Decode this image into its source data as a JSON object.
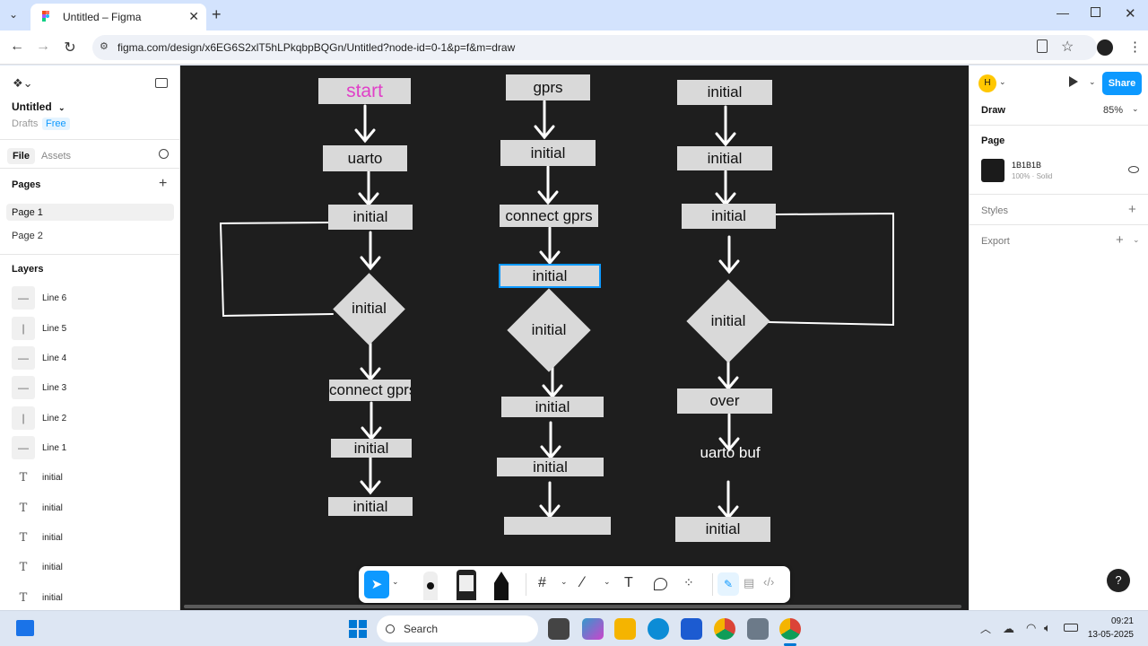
{
  "browser": {
    "tab_title": "Untitled – Figma",
    "url": "figma.com/design/x6EG6S2xlT5hLPkqbpBQGn/Untitled?node-id=0-1&p=f&m=draw"
  },
  "left_panel": {
    "file_name": "Untitled",
    "drafts": "Drafts",
    "plan_badge": "Free",
    "tab_file": "File",
    "tab_assets": "Assets",
    "pages_title": "Pages",
    "pages": [
      "Page 1",
      "Page 2"
    ],
    "layers_title": "Layers",
    "layers": [
      {
        "name": "Line 6",
        "kind": "line"
      },
      {
        "name": "Line 5",
        "kind": "line"
      },
      {
        "name": "Line 4",
        "kind": "line"
      },
      {
        "name": "Line 3",
        "kind": "line"
      },
      {
        "name": "Line 2",
        "kind": "line"
      },
      {
        "name": "Line 1",
        "kind": "line"
      },
      {
        "name": "initial",
        "kind": "text"
      },
      {
        "name": "initial",
        "kind": "text"
      },
      {
        "name": "initial",
        "kind": "text"
      },
      {
        "name": "initial",
        "kind": "text"
      },
      {
        "name": "initial",
        "kind": "text"
      }
    ]
  },
  "canvas": {
    "col1": [
      "start",
      "uarto",
      "initial",
      "initial",
      "connect gprs",
      "initial",
      "initial"
    ],
    "col2": [
      "gprs",
      "initial",
      "connect gprs",
      "initial",
      "initial",
      "initial",
      "initial",
      ""
    ],
    "col3": [
      "initial",
      "initial",
      "initial",
      "initial",
      "over",
      "uarto buf",
      "initial"
    ],
    "start_color": "#e040c8",
    "selection_color": "#0d99ff"
  },
  "right_panel": {
    "avatar_letter": "H",
    "share_label": "Share",
    "mode_label": "Draw",
    "zoom": "85%",
    "page_section": "Page",
    "page_color_hex": "1B1B1B",
    "page_color_detail": "100% · Solid",
    "styles_label": "Styles",
    "export_label": "Export",
    "help_label": "?"
  },
  "taskbar": {
    "search_label": "Search",
    "time": "09:21",
    "date": "13-05-2025"
  }
}
